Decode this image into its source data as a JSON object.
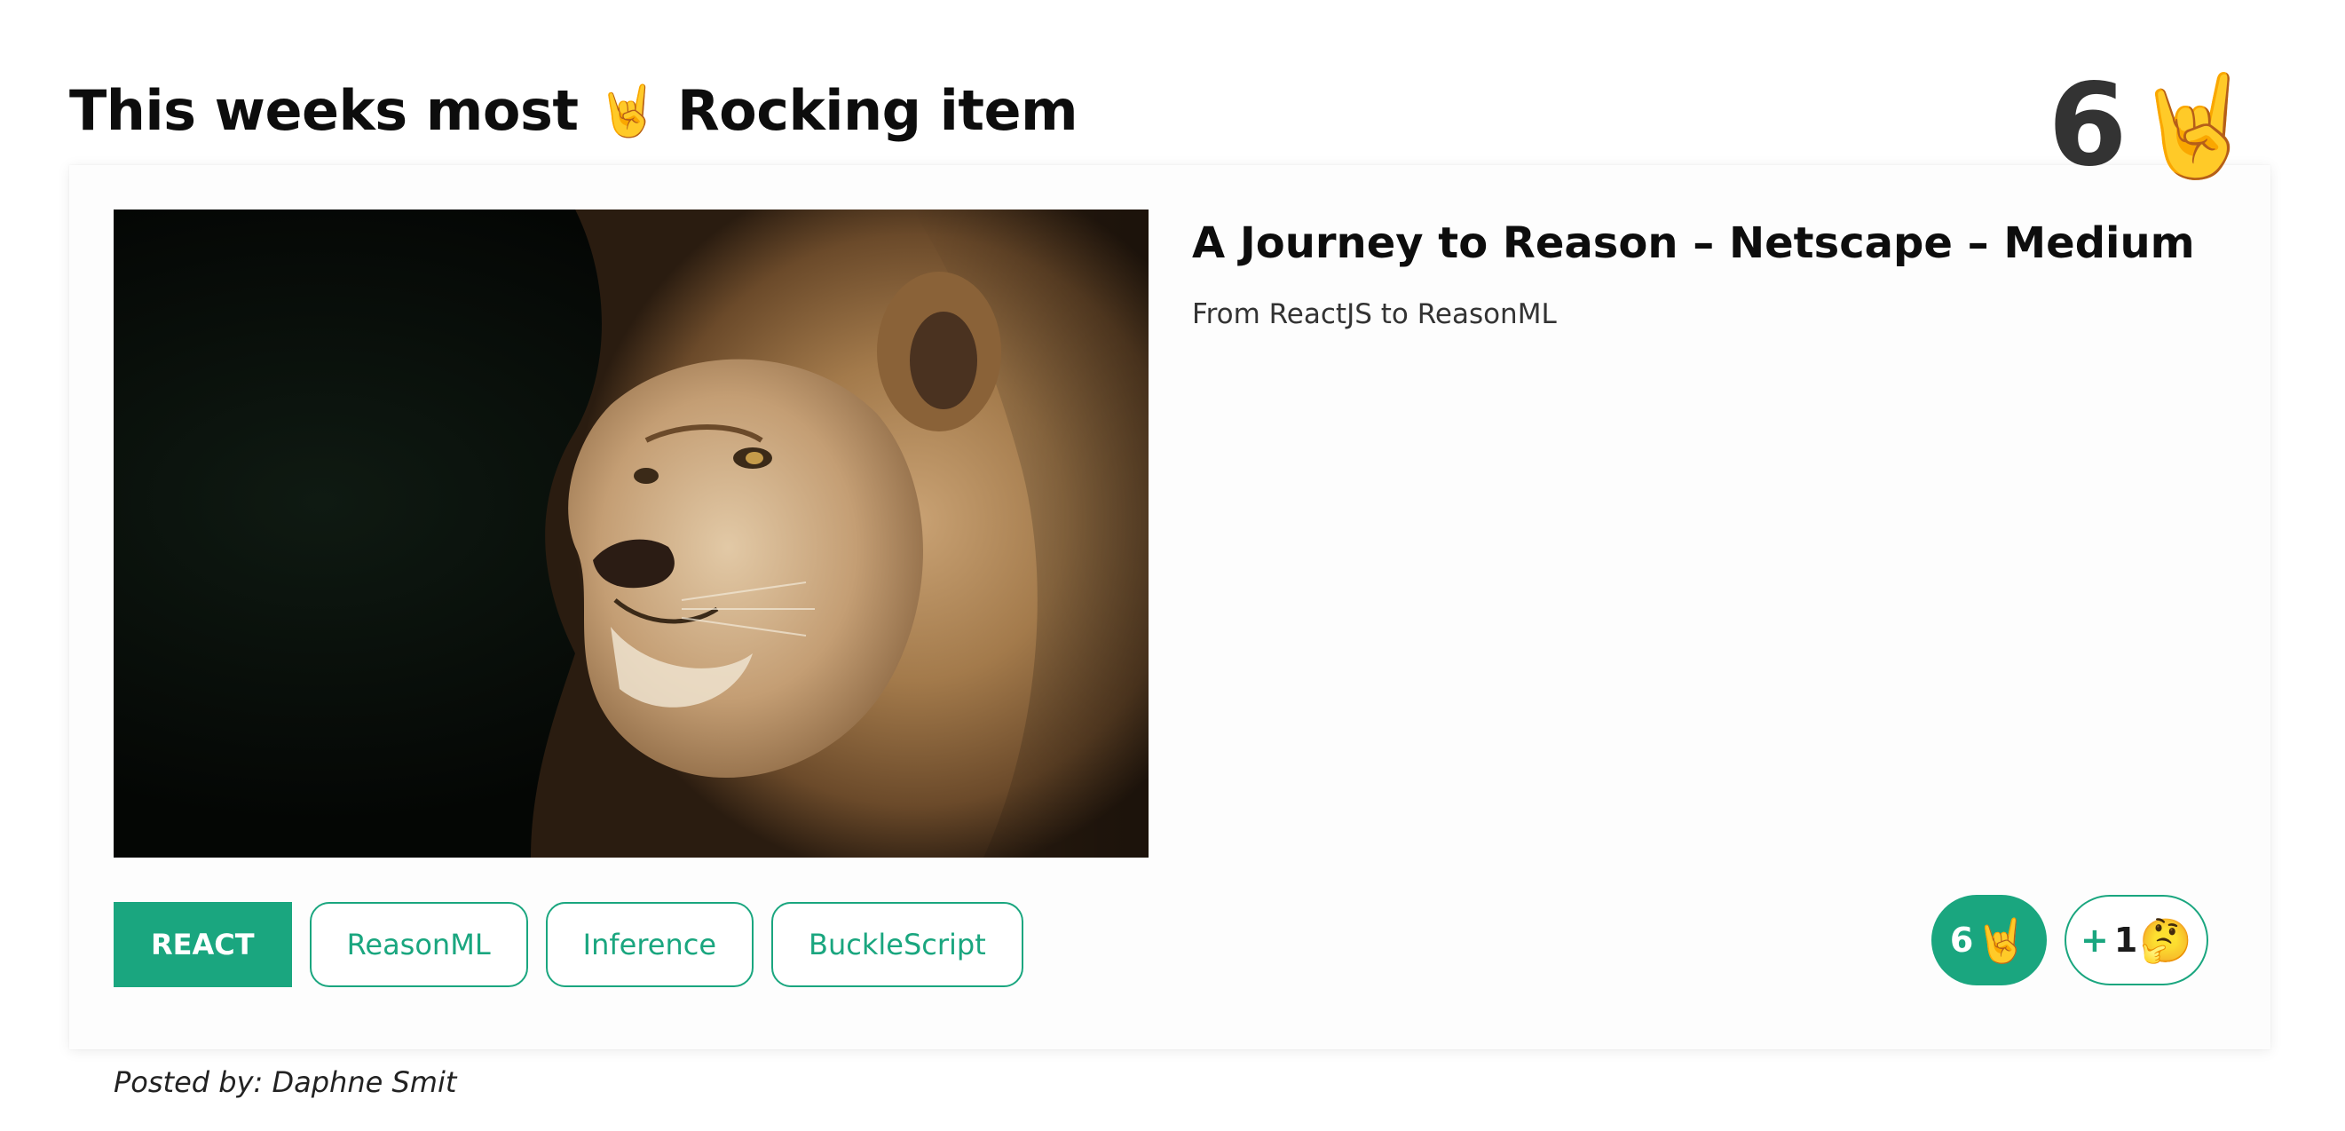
{
  "header": {
    "title_prefix": "This weeks most",
    "title_emoji": "🤘",
    "title_suffix": "Rocking item",
    "score": "6",
    "score_emoji": "🤘"
  },
  "item": {
    "image_alt": "Lion",
    "title": "A Journey to Reason – Netscape – Medium",
    "subtitle": "From ReactJS to ReasonML",
    "tags": [
      {
        "label": "REACT",
        "active": true
      },
      {
        "label": "ReasonML",
        "active": false
      },
      {
        "label": "Inference",
        "active": false
      },
      {
        "label": "BuckleScript",
        "active": false
      }
    ],
    "reactions": {
      "rock_count": "6",
      "rock_emoji": "🤘",
      "think_plus": "+",
      "think_count": "1",
      "think_emoji": "🤔"
    }
  },
  "footer": {
    "posted_by": "Posted by: Daphne Smit"
  },
  "colors": {
    "accent": "#1aa67f",
    "heading": "#0d0d0d",
    "score": "#333333"
  }
}
